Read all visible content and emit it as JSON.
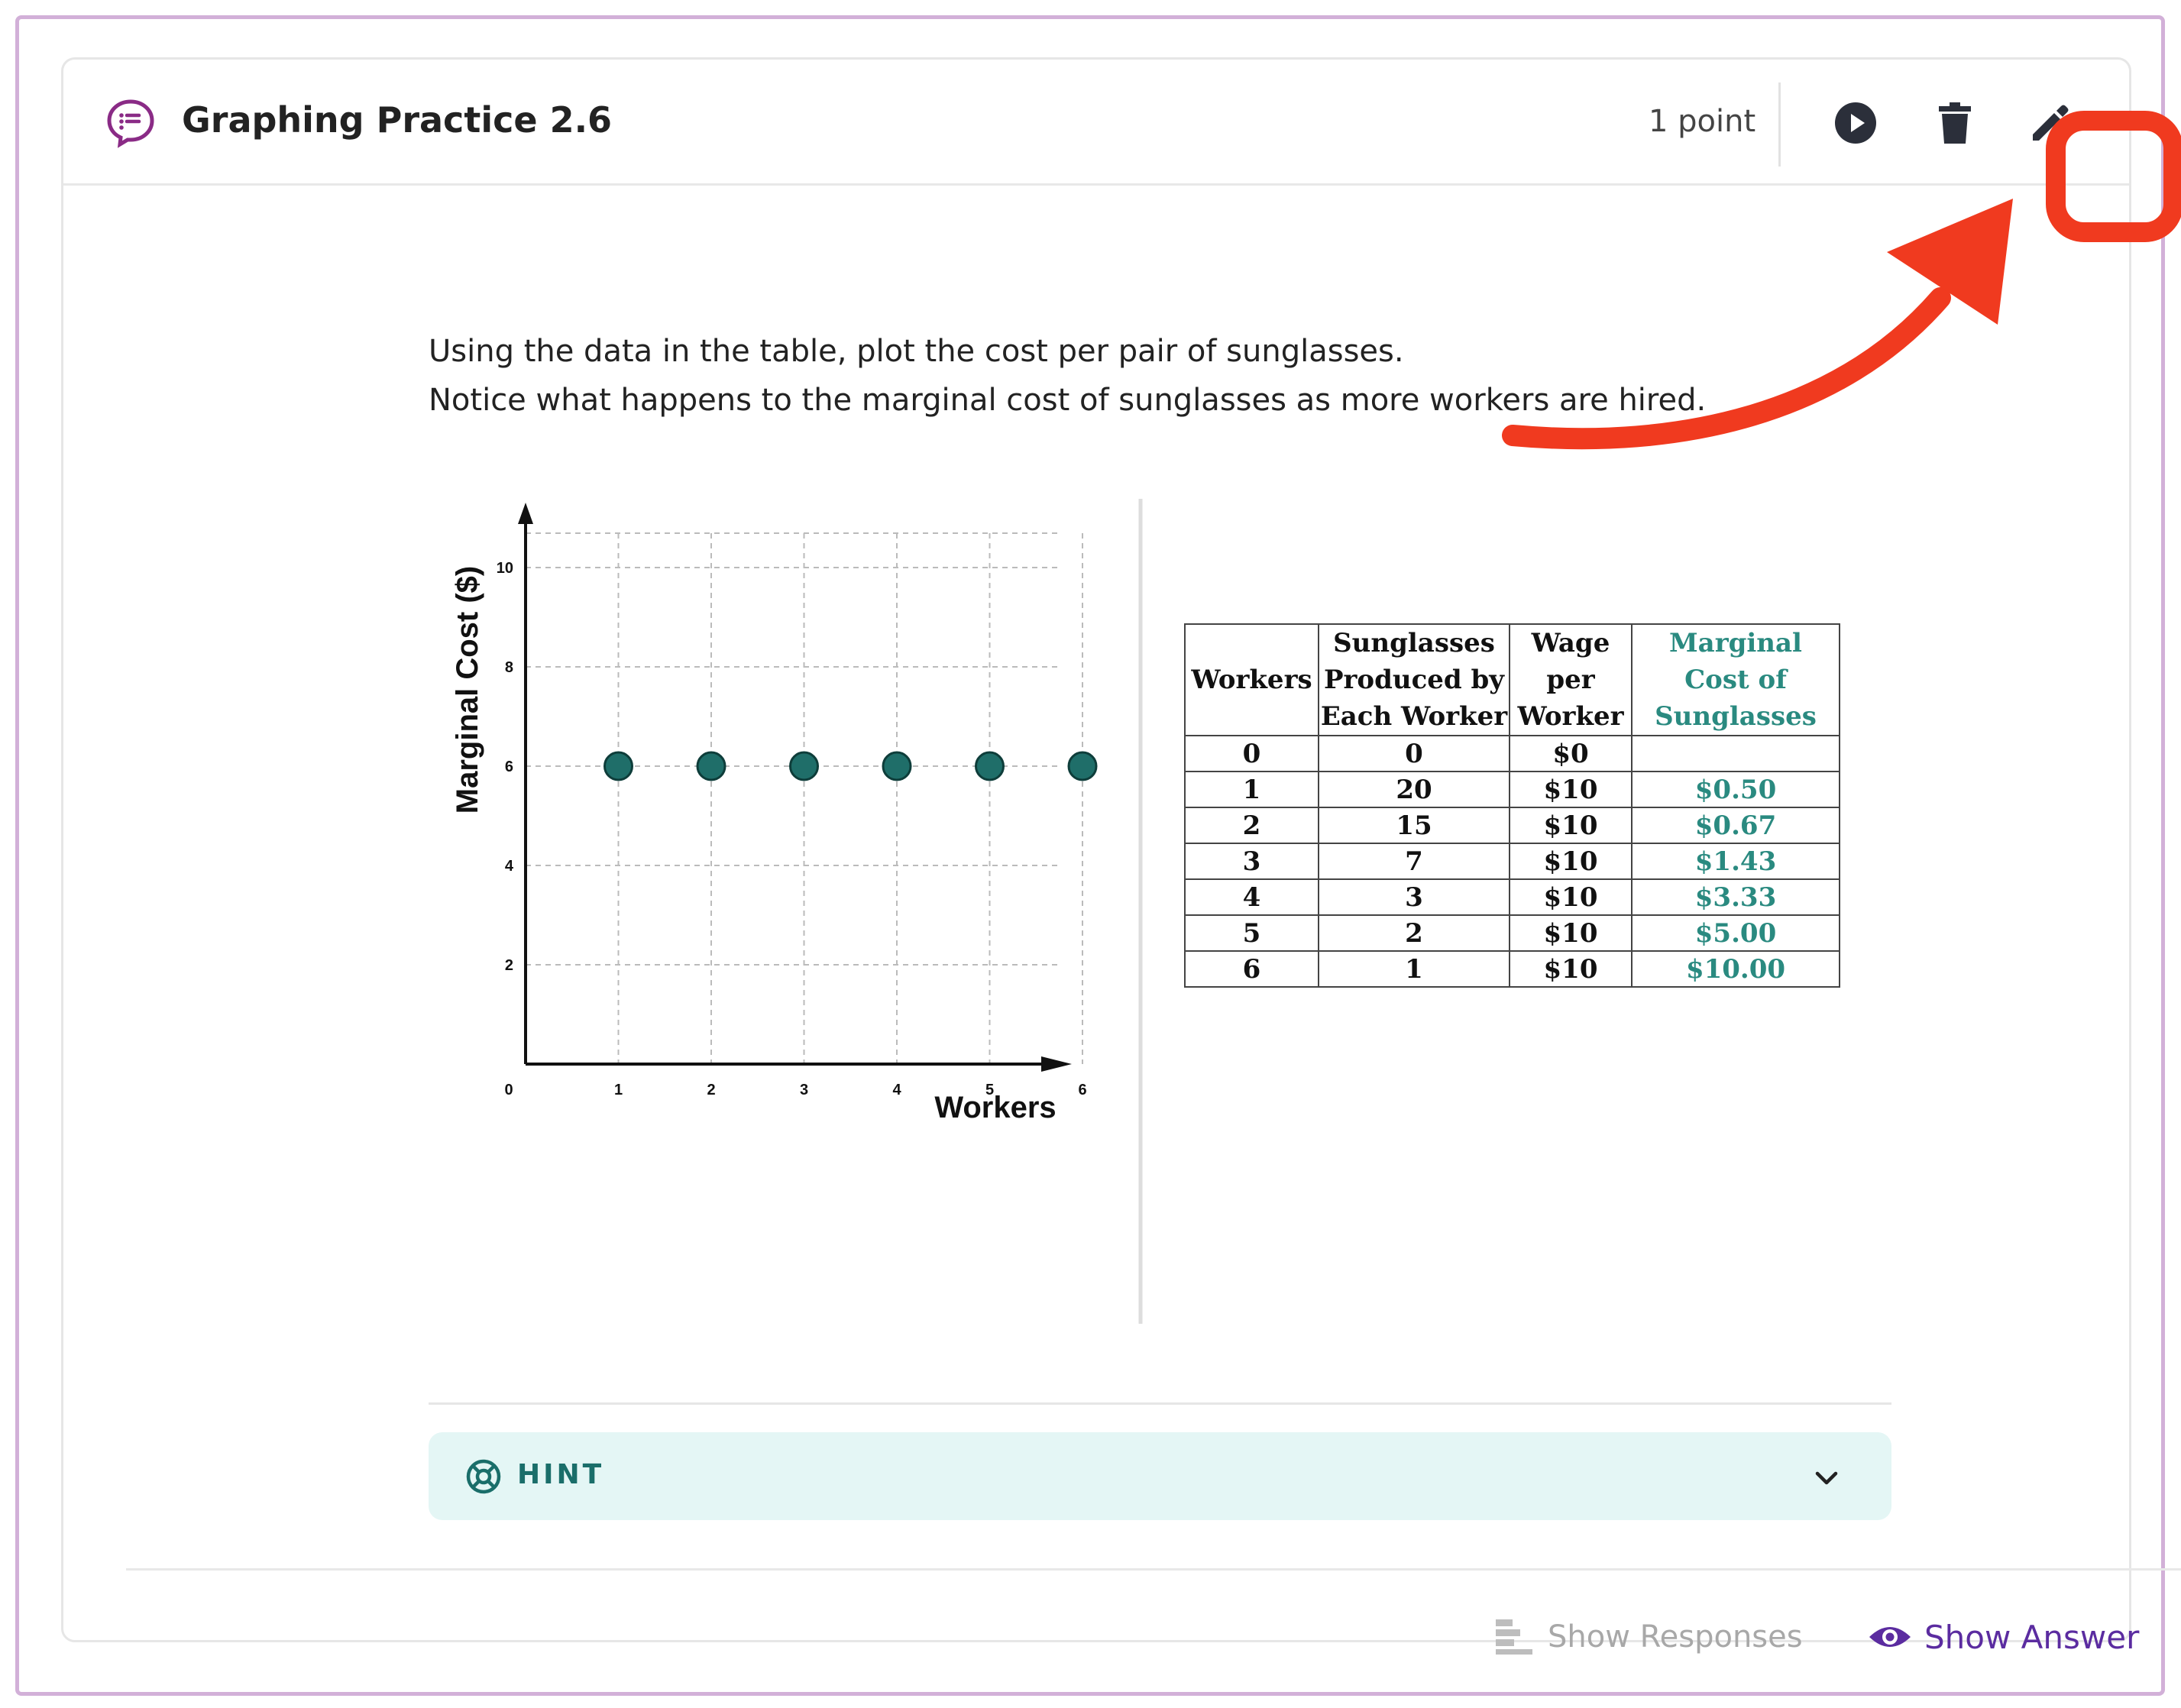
{
  "question": {
    "title": "Graphing Practice 2.6",
    "points": "1 point"
  },
  "header_actions": {
    "preview_icon": "play-circle-icon",
    "delete_icon": "trash-icon",
    "edit_icon": "pencil-icon"
  },
  "instructions": {
    "line1": "Using the data in the table, plot the cost per pair of sunglasses.",
    "line2": "Notice what happens to the marginal cost of sunglasses as more workers are hired."
  },
  "chart_data": {
    "type": "scatter",
    "xlabel": "Workers",
    "ylabel": "Marginal Cost ($)",
    "xlim": [
      0,
      7
    ],
    "ylim": [
      0,
      11
    ],
    "x_ticks": [
      "0",
      "1",
      "2",
      "3",
      "4",
      "5",
      "6"
    ],
    "y_ticks": [
      "2",
      "4",
      "6",
      "8",
      "10"
    ],
    "grid": true,
    "point_color": "#1f6e69",
    "points": [
      {
        "x": 1,
        "y": 6
      },
      {
        "x": 2,
        "y": 6
      },
      {
        "x": 3,
        "y": 6
      },
      {
        "x": 4,
        "y": 6
      },
      {
        "x": 5,
        "y": 6
      },
      {
        "x": 6,
        "y": 6
      }
    ]
  },
  "table": {
    "headers": [
      "Workers",
      "Sunglasses Produced by Each Worker",
      "Wage per Worker",
      "Marginal Cost of Sunglasses"
    ],
    "rows": [
      [
        "0",
        "0",
        "$0",
        ""
      ],
      [
        "1",
        "20",
        "$10",
        "$0.50"
      ],
      [
        "2",
        "15",
        "$10",
        "$0.67"
      ],
      [
        "3",
        "7",
        "$10",
        "$1.43"
      ],
      [
        "4",
        "3",
        "$10",
        "$3.33"
      ],
      [
        "5",
        "2",
        "$10",
        "$5.00"
      ],
      [
        "6",
        "1",
        "$10",
        "$10.00"
      ]
    ]
  },
  "hint": {
    "label": "HINT"
  },
  "footer": {
    "show_responses": "Show Responses",
    "show_answer": "Show Answer"
  },
  "colors": {
    "accent_purple": "#5b2ca0",
    "annotation_red": "#f03a1f",
    "teal": "#1f6e69",
    "hint_bg": "#e4f6f5"
  }
}
